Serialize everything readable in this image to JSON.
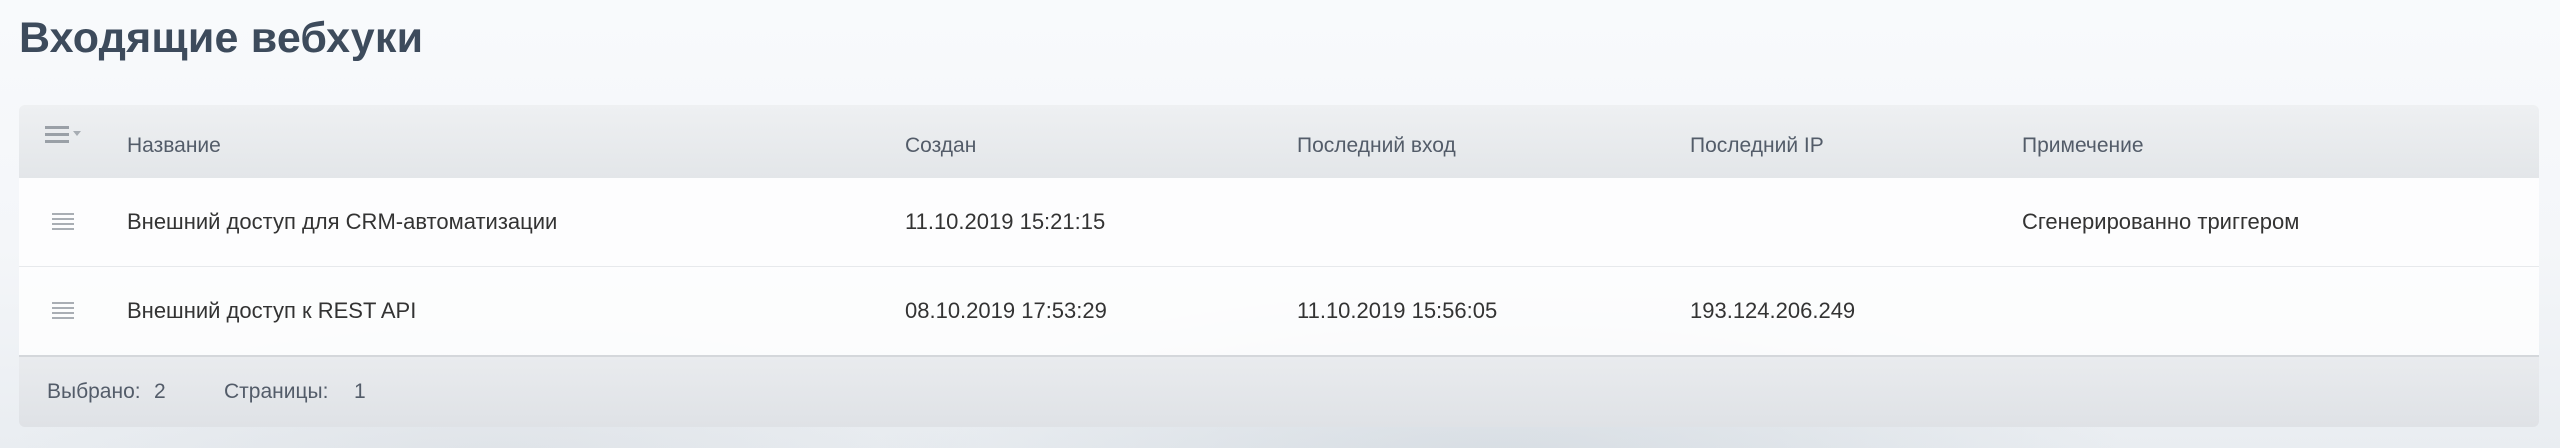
{
  "page": {
    "title": "Входящие вебхуки"
  },
  "table": {
    "columns": [
      "Название",
      "Создан",
      "Последний вход",
      "Последний IP",
      "Примечение"
    ],
    "rows": [
      {
        "name": "Внешний доступ для CRM-автоматизации",
        "created": "11.10.2019 15:21:15",
        "last_login": "",
        "last_ip": "",
        "note": "Сгенерированно триггером"
      },
      {
        "name": "Внешний доступ к REST API",
        "created": "08.10.2019 17:53:29",
        "last_login": "11.10.2019 15:56:05",
        "last_ip": "193.124.206.249",
        "note": ""
      }
    ]
  },
  "footer": {
    "selected_label": "Выбрано:",
    "selected_count": "2",
    "pages_label": "Страницы:",
    "pages_value": "1"
  },
  "icons": {
    "settings": "list-settings-icon",
    "row_menu": "row-menu-icon"
  }
}
